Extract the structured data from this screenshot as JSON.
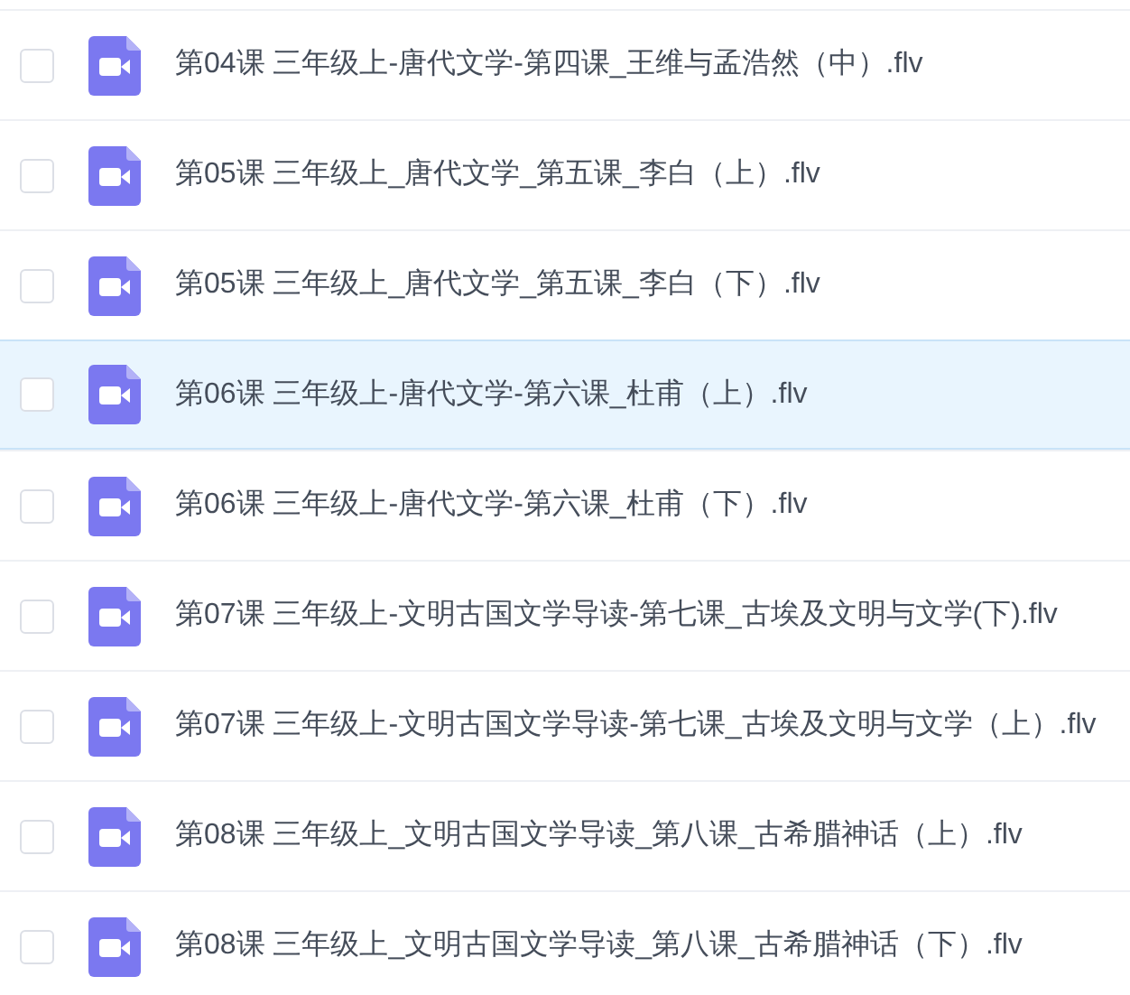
{
  "files": [
    {
      "name": "第04课 三年级上-唐代文学-第四课_王维与孟浩然（中）.flv",
      "checked": false,
      "selected": false
    },
    {
      "name": "第05课 三年级上_唐代文学_第五课_李白（上）.flv",
      "checked": false,
      "selected": false
    },
    {
      "name": "第05课 三年级上_唐代文学_第五课_李白（下）.flv",
      "checked": false,
      "selected": false
    },
    {
      "name": "第06课 三年级上-唐代文学-第六课_杜甫（上）.flv",
      "checked": false,
      "selected": true
    },
    {
      "name": "第06课 三年级上-唐代文学-第六课_杜甫（下）.flv",
      "checked": false,
      "selected": false
    },
    {
      "name": "第07课 三年级上-文明古国文学导读-第七课_古埃及文明与文学(下).flv",
      "checked": false,
      "selected": false
    },
    {
      "name": "第07课 三年级上-文明古国文学导读-第七课_古埃及文明与文学（上）.flv",
      "checked": false,
      "selected": false
    },
    {
      "name": "第08课 三年级上_文明古国文学导读_第八课_古希腊神话（上）.flv",
      "checked": false,
      "selected": false
    },
    {
      "name": "第08课 三年级上_文明古国文学导读_第八课_古希腊神话（下）.flv",
      "checked": false,
      "selected": false
    }
  ]
}
